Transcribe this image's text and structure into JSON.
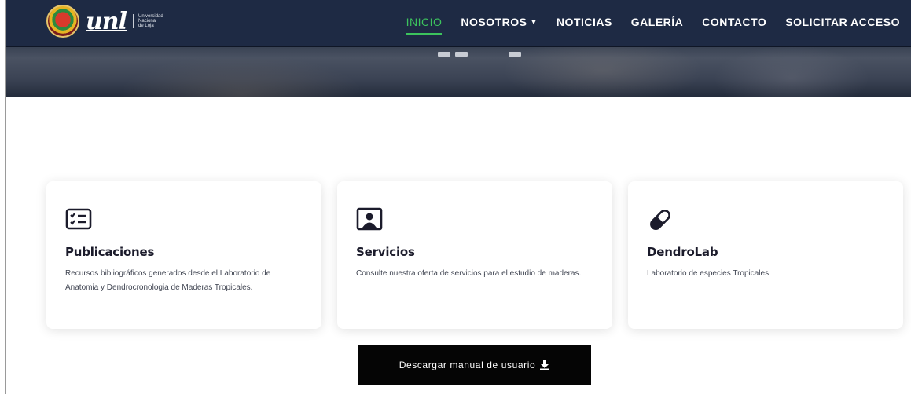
{
  "branding": {
    "logo_word": "unl",
    "logo_sub_lines": [
      "Universidad",
      "Nacional",
      "de Loja"
    ]
  },
  "nav": {
    "items": [
      {
        "label": "INICIO",
        "active": true
      },
      {
        "label": "NOSOTROS",
        "has_dropdown": true
      },
      {
        "label": "NOTICIAS"
      },
      {
        "label": "GALERÍA"
      },
      {
        "label": "CONTACTO"
      },
      {
        "label": "SOLICITAR ACCESO"
      }
    ],
    "active_color": "#3cc35d",
    "bar_color": "#1e2a44"
  },
  "carousel": {
    "indicator_count": 3
  },
  "cards": [
    {
      "icon": "checklist-icon",
      "title": "Publicaciones",
      "description": "Recursos bibliográficos generados desde el Laboratorio de Anatomia y Dendrocronologia de Maderas Tropicales."
    },
    {
      "icon": "user-presentation-icon",
      "title": "Servicios",
      "description": "Consulte nuestra oferta de servicios para el estudio de maderas."
    },
    {
      "icon": "capsule-icon",
      "title": "DendroLab",
      "description": "Laboratorio de especies Tropicales"
    }
  ],
  "download_button": {
    "label": "Descargar manual de usuario",
    "icon": "download-icon"
  }
}
